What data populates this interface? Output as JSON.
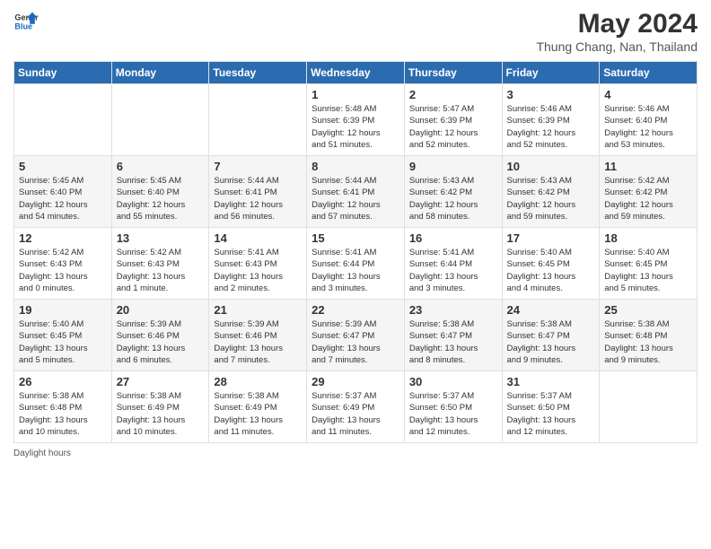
{
  "header": {
    "logo_line1": "General",
    "logo_line2": "Blue",
    "month_year": "May 2024",
    "location": "Thung Chang, Nan, Thailand"
  },
  "days_of_week": [
    "Sunday",
    "Monday",
    "Tuesday",
    "Wednesday",
    "Thursday",
    "Friday",
    "Saturday"
  ],
  "weeks": [
    [
      {
        "day": "",
        "info": ""
      },
      {
        "day": "",
        "info": ""
      },
      {
        "day": "",
        "info": ""
      },
      {
        "day": "1",
        "info": "Sunrise: 5:48 AM\nSunset: 6:39 PM\nDaylight: 12 hours\nand 51 minutes."
      },
      {
        "day": "2",
        "info": "Sunrise: 5:47 AM\nSunset: 6:39 PM\nDaylight: 12 hours\nand 52 minutes."
      },
      {
        "day": "3",
        "info": "Sunrise: 5:46 AM\nSunset: 6:39 PM\nDaylight: 12 hours\nand 52 minutes."
      },
      {
        "day": "4",
        "info": "Sunrise: 5:46 AM\nSunset: 6:40 PM\nDaylight: 12 hours\nand 53 minutes."
      }
    ],
    [
      {
        "day": "5",
        "info": "Sunrise: 5:45 AM\nSunset: 6:40 PM\nDaylight: 12 hours\nand 54 minutes."
      },
      {
        "day": "6",
        "info": "Sunrise: 5:45 AM\nSunset: 6:40 PM\nDaylight: 12 hours\nand 55 minutes."
      },
      {
        "day": "7",
        "info": "Sunrise: 5:44 AM\nSunset: 6:41 PM\nDaylight: 12 hours\nand 56 minutes."
      },
      {
        "day": "8",
        "info": "Sunrise: 5:44 AM\nSunset: 6:41 PM\nDaylight: 12 hours\nand 57 minutes."
      },
      {
        "day": "9",
        "info": "Sunrise: 5:43 AM\nSunset: 6:42 PM\nDaylight: 12 hours\nand 58 minutes."
      },
      {
        "day": "10",
        "info": "Sunrise: 5:43 AM\nSunset: 6:42 PM\nDaylight: 12 hours\nand 59 minutes."
      },
      {
        "day": "11",
        "info": "Sunrise: 5:42 AM\nSunset: 6:42 PM\nDaylight: 12 hours\nand 59 minutes."
      }
    ],
    [
      {
        "day": "12",
        "info": "Sunrise: 5:42 AM\nSunset: 6:43 PM\nDaylight: 13 hours\nand 0 minutes."
      },
      {
        "day": "13",
        "info": "Sunrise: 5:42 AM\nSunset: 6:43 PM\nDaylight: 13 hours\nand 1 minute."
      },
      {
        "day": "14",
        "info": "Sunrise: 5:41 AM\nSunset: 6:43 PM\nDaylight: 13 hours\nand 2 minutes."
      },
      {
        "day": "15",
        "info": "Sunrise: 5:41 AM\nSunset: 6:44 PM\nDaylight: 13 hours\nand 3 minutes."
      },
      {
        "day": "16",
        "info": "Sunrise: 5:41 AM\nSunset: 6:44 PM\nDaylight: 13 hours\nand 3 minutes."
      },
      {
        "day": "17",
        "info": "Sunrise: 5:40 AM\nSunset: 6:45 PM\nDaylight: 13 hours\nand 4 minutes."
      },
      {
        "day": "18",
        "info": "Sunrise: 5:40 AM\nSunset: 6:45 PM\nDaylight: 13 hours\nand 5 minutes."
      }
    ],
    [
      {
        "day": "19",
        "info": "Sunrise: 5:40 AM\nSunset: 6:45 PM\nDaylight: 13 hours\nand 5 minutes."
      },
      {
        "day": "20",
        "info": "Sunrise: 5:39 AM\nSunset: 6:46 PM\nDaylight: 13 hours\nand 6 minutes."
      },
      {
        "day": "21",
        "info": "Sunrise: 5:39 AM\nSunset: 6:46 PM\nDaylight: 13 hours\nand 7 minutes."
      },
      {
        "day": "22",
        "info": "Sunrise: 5:39 AM\nSunset: 6:47 PM\nDaylight: 13 hours\nand 7 minutes."
      },
      {
        "day": "23",
        "info": "Sunrise: 5:38 AM\nSunset: 6:47 PM\nDaylight: 13 hours\nand 8 minutes."
      },
      {
        "day": "24",
        "info": "Sunrise: 5:38 AM\nSunset: 6:47 PM\nDaylight: 13 hours\nand 9 minutes."
      },
      {
        "day": "25",
        "info": "Sunrise: 5:38 AM\nSunset: 6:48 PM\nDaylight: 13 hours\nand 9 minutes."
      }
    ],
    [
      {
        "day": "26",
        "info": "Sunrise: 5:38 AM\nSunset: 6:48 PM\nDaylight: 13 hours\nand 10 minutes."
      },
      {
        "day": "27",
        "info": "Sunrise: 5:38 AM\nSunset: 6:49 PM\nDaylight: 13 hours\nand 10 minutes."
      },
      {
        "day": "28",
        "info": "Sunrise: 5:38 AM\nSunset: 6:49 PM\nDaylight: 13 hours\nand 11 minutes."
      },
      {
        "day": "29",
        "info": "Sunrise: 5:37 AM\nSunset: 6:49 PM\nDaylight: 13 hours\nand 11 minutes."
      },
      {
        "day": "30",
        "info": "Sunrise: 5:37 AM\nSunset: 6:50 PM\nDaylight: 13 hours\nand 12 minutes."
      },
      {
        "day": "31",
        "info": "Sunrise: 5:37 AM\nSunset: 6:50 PM\nDaylight: 13 hours\nand 12 minutes."
      },
      {
        "day": "",
        "info": ""
      }
    ]
  ],
  "footer": {
    "daylight_label": "Daylight hours"
  }
}
